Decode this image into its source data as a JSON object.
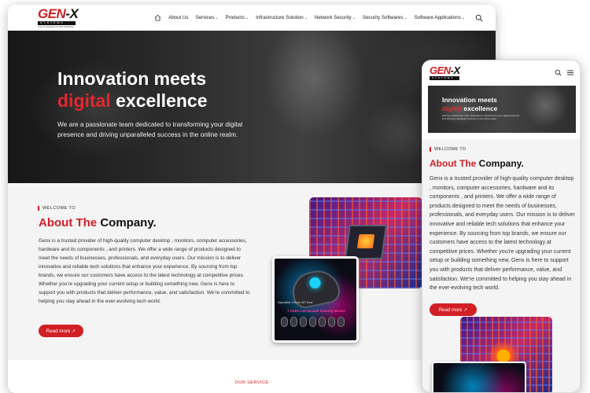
{
  "brand": {
    "logo_text_main": "GEN",
    "logo_text_x": "-X",
    "logo_sub": "SYSTEMS",
    "logo_tag": "Your IT Solutions & Tech Solutions"
  },
  "nav": {
    "items": [
      {
        "label": "About Us",
        "has_dropdown": false
      },
      {
        "label": "Services",
        "has_dropdown": true
      },
      {
        "label": "Products",
        "has_dropdown": true
      },
      {
        "label": "Infrastructure Solution",
        "has_dropdown": true
      },
      {
        "label": "Network Security",
        "has_dropdown": true
      },
      {
        "label": "Security Softwares",
        "has_dropdown": true
      },
      {
        "label": "Software Applications",
        "has_dropdown": true
      }
    ],
    "dropdown_glyph": "⌄"
  },
  "hero": {
    "line1": "Innovation meets",
    "accent": "digital",
    "line2_rest": " excellence",
    "paragraph": "We are a passionate team dedicated to transforming your digital presence and driving unparalleled success in the online realm."
  },
  "about": {
    "eyebrow": "WELCOME TO",
    "title_accent": "About The",
    "title_rest": " Company.",
    "paragraph": "Genx is a trusted provider of high-quality computer desktop , monitors, computer accessories, hardware and its components , and printers. We offer a wide range of products designed to meet the needs of businesses, professionals, and everyday users. Our mission is to deliver innovative and reliable tech solutions that enhance your experience. By sourcing from top brands, we ensure our customers have access to the latest technology at competitive prices. Whether you're upgrading your current setup or building something new, Genx is here to support you with products that deliver performance, value, and satisfaction. We're committed to helping you stay ahead in the ever-evolving tech world.",
    "button_label": "Read more ↗"
  },
  "product_images": {
    "mouse_caption": "7 Color Led Breath Gaming Mouse",
    "mouse_small_text": "Adjustable 4 Mode DPI Gear"
  },
  "service": {
    "title": "OUR SERVICE"
  },
  "colors": {
    "accent": "#d21f26",
    "dark": "#111111",
    "light_bg": "#f4f4f4"
  },
  "icons": {
    "home": "home-icon",
    "search": "search-icon",
    "menu": "hamburger-icon",
    "arrow": "arrow-up-right-icon"
  }
}
